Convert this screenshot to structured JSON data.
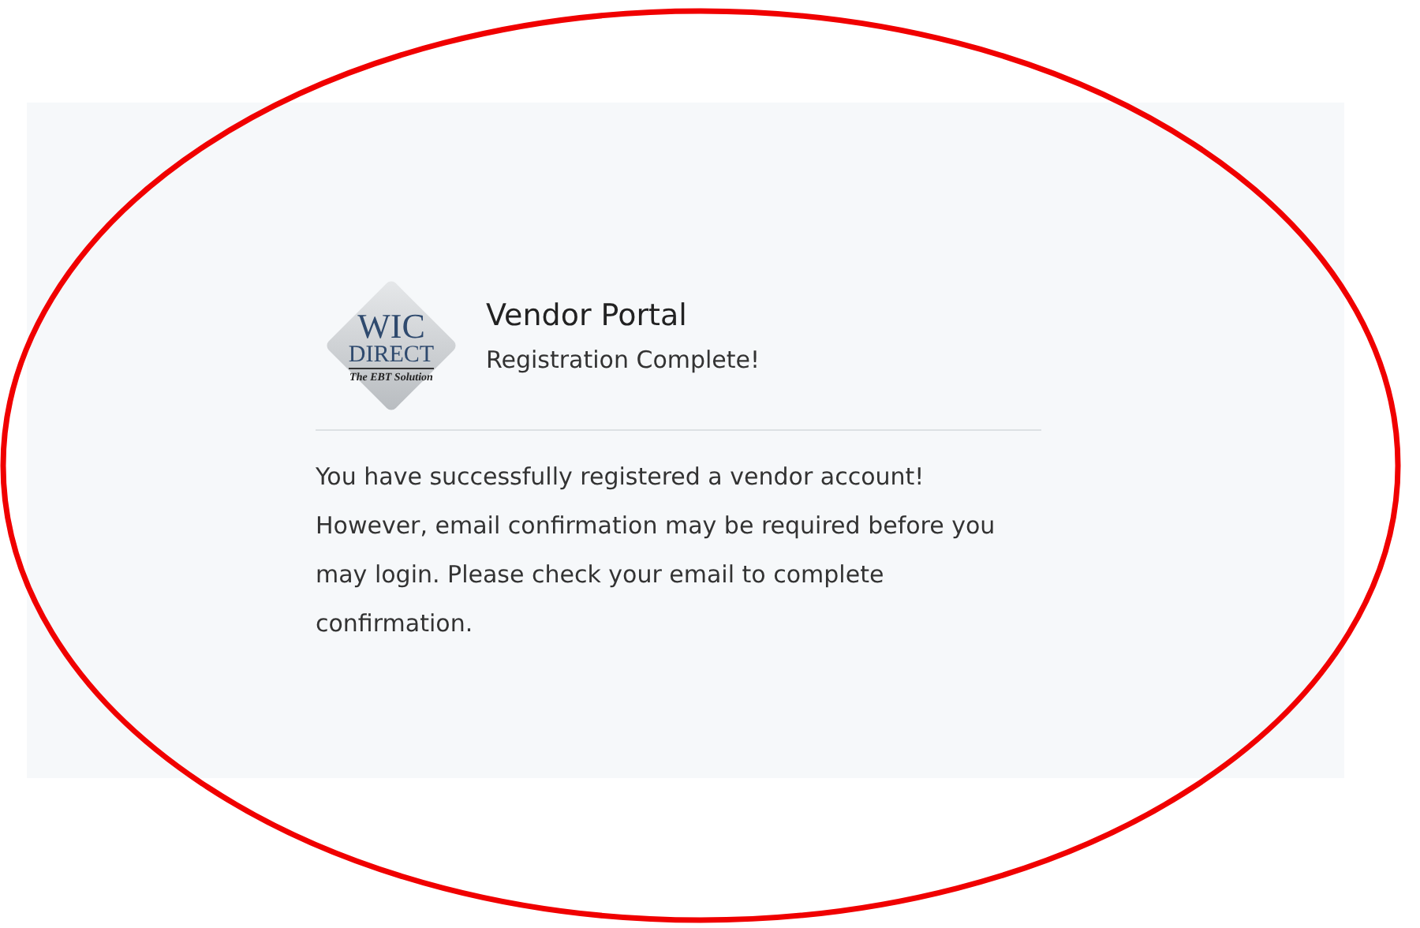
{
  "logo": {
    "lines": [
      "WIC",
      "DIRECT",
      "The EBT Solution"
    ]
  },
  "header": {
    "title": "Vendor Portal",
    "subtitle": "Registration Complete!"
  },
  "message": "You have successfully registered a vendor account! However, email confirmation may be required before you may login. Please check your email to complete confirmation."
}
